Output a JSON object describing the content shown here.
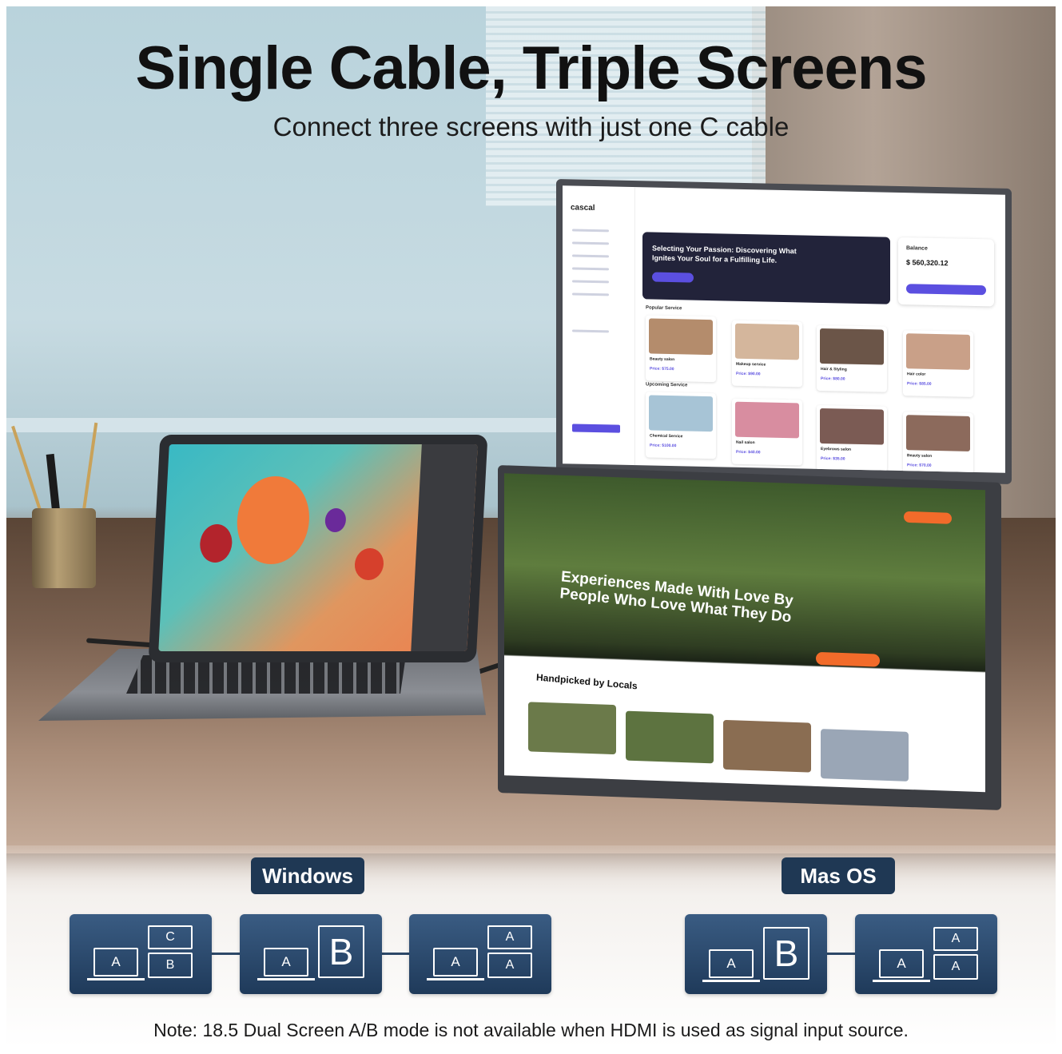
{
  "headline": "Single Cable, Triple Screens",
  "subheadline": "Connect three screens with just one C cable",
  "dashboard": {
    "brand": "cascal",
    "hero_text": "Selecting Your Passion: Discovering What Ignites Your Soul for a Fulfilling Life.",
    "balance_label": "Balance",
    "balance_value": "$ 560,320.12",
    "popular_label": "Popular Service",
    "upcoming_label": "Upcoming Service",
    "popular": [
      {
        "name": "Beauty salon",
        "price": "Price: $75.00"
      },
      {
        "name": "Makeup service",
        "price": "Price: $90.00"
      },
      {
        "name": "Hair & Styling",
        "price": "Price: $80.00"
      },
      {
        "name": "Hair color",
        "price": "Price: $85.00"
      }
    ],
    "upcoming": [
      {
        "name": "Chemical Service",
        "price": "Price: $100.00"
      },
      {
        "name": "Nail salon",
        "price": "Price: $40.00"
      },
      {
        "name": "Eyebrows salon",
        "price": "Price: $35.00"
      },
      {
        "name": "Beauty salon",
        "price": "Price: $70.00"
      }
    ]
  },
  "travel_site": {
    "hero_text": "Experiences Made With Love By People Who Love What They Do",
    "section_title": "Handpicked by Locals"
  },
  "os_modes": {
    "windows_label": "Windows",
    "mac_label": "Mas OS",
    "windows_tiles": [
      {
        "laptop": "A",
        "screens": [
          "C",
          "B"
        ]
      },
      {
        "laptop": "A",
        "screens": [
          "B"
        ]
      },
      {
        "laptop": "A",
        "screens": [
          "A",
          "A"
        ]
      }
    ],
    "mac_tiles": [
      {
        "laptop": "A",
        "screens": [
          "B"
        ]
      },
      {
        "laptop": "A",
        "screens": [
          "A",
          "A"
        ]
      }
    ]
  },
  "note": "Note: 18.5 Dual Screen A/B mode is not available when HDMI is used as signal input source.",
  "colors": {
    "badge": "#1f3854",
    "tile_top": "#3a5c83",
    "tile_bottom": "#1f3a5a",
    "accent_purple": "#5b4fe0",
    "accent_orange": "#f26b2a"
  }
}
